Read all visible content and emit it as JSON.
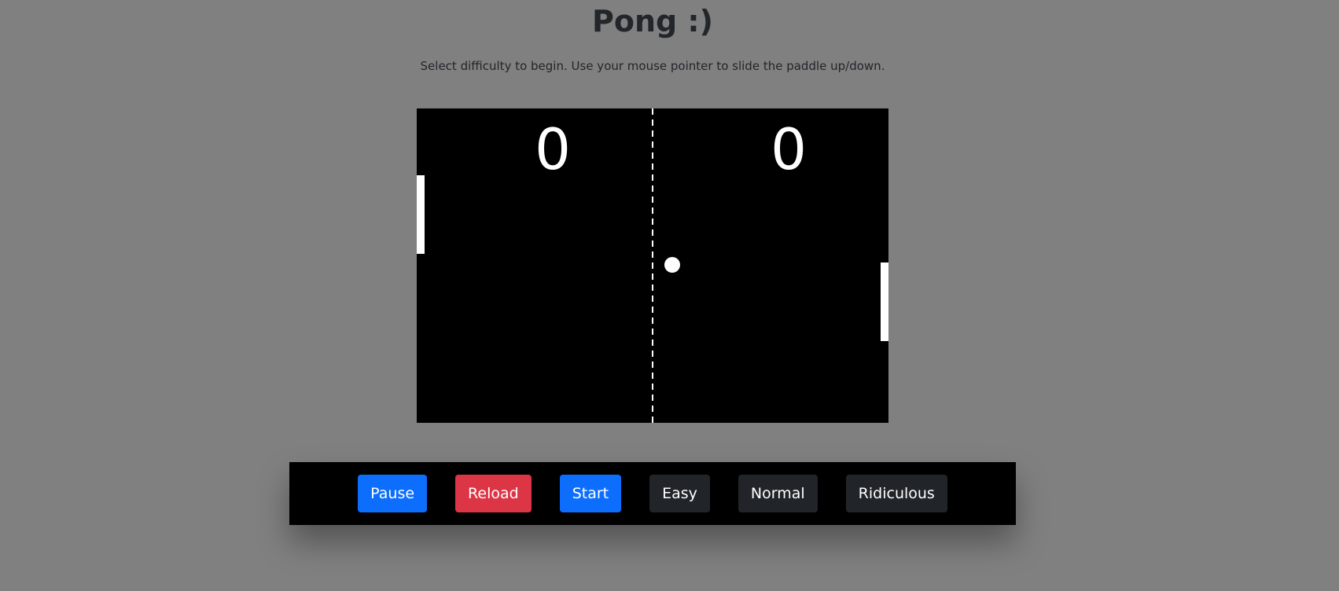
{
  "header": {
    "title": "Pong :)",
    "instructions": "Select difficulty to begin. Use your mouse pointer to slide the paddle up/down."
  },
  "game": {
    "score_left": "0",
    "score_right": "0"
  },
  "controls": {
    "pause_label": "Pause",
    "reload_label": "Reload",
    "start_label": "Start",
    "easy_label": "Easy",
    "normal_label": "Normal",
    "ridiculous_label": "Ridiculous"
  },
  "colors": {
    "background": "#808080",
    "court": "#000000",
    "primary": "#0d6efd",
    "danger": "#dc3545",
    "dark": "#212529"
  }
}
